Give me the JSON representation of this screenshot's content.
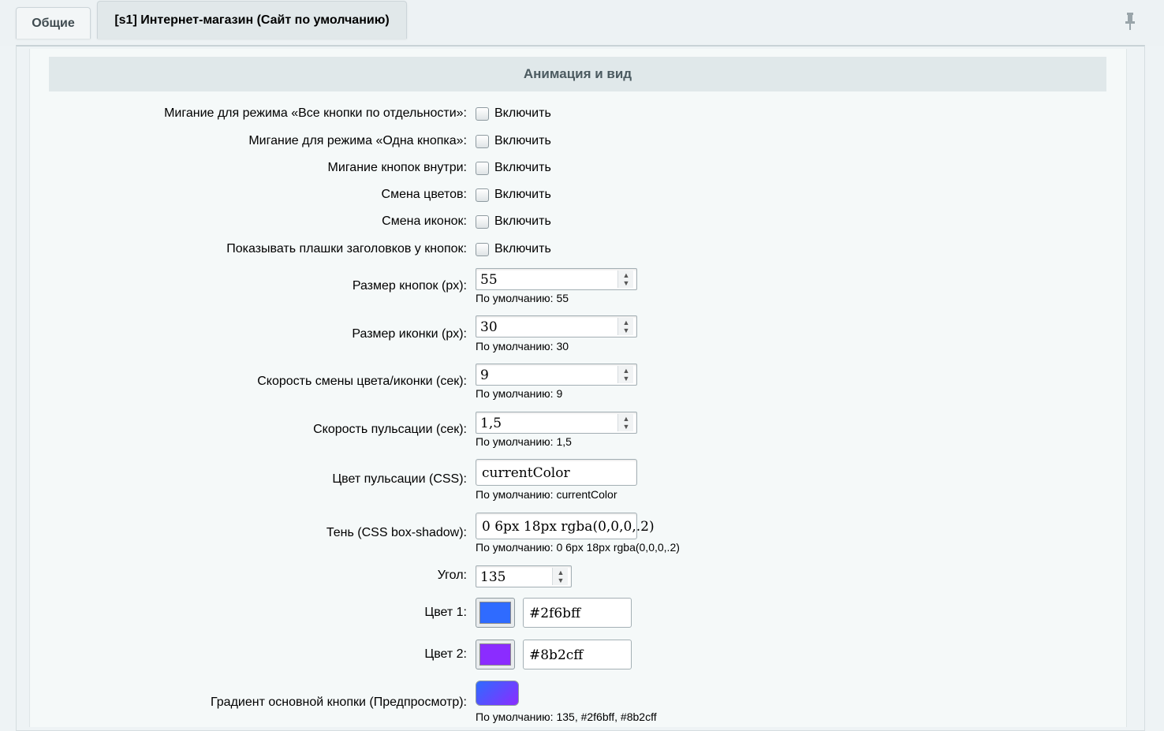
{
  "tabs": [
    {
      "label": "Общие"
    },
    {
      "label": "[s1] Интернет-магазин (Сайт по умолчанию)"
    }
  ],
  "section_title": "Анимация и вид",
  "checkboxes": [
    {
      "label": "Мигание для режима «Все кнопки по отдельности»:",
      "text": "Включить"
    },
    {
      "label": "Мигание для режима «Одна кнопка»:",
      "text": "Включить"
    },
    {
      "label": "Мигание кнопок внутри:",
      "text": "Включить"
    },
    {
      "label": "Смена цветов:",
      "text": "Включить"
    },
    {
      "label": "Смена иконок:",
      "text": "Включить"
    },
    {
      "label": "Показывать плашки заголовков у кнопок:",
      "text": "Включить"
    }
  ],
  "numbers": [
    {
      "label": "Размер кнопок (px):",
      "value": "55",
      "hint": "По умолчанию: 55"
    },
    {
      "label": "Размер иконки (px):",
      "value": "30",
      "hint": "По умолчанию: 30"
    },
    {
      "label": "Скорость смены цвета/иконки (сек):",
      "value": "9",
      "hint": "По умолчанию: 9"
    },
    {
      "label": "Скорость пульсации (сек):",
      "value": "1,5",
      "hint": "По умолчанию: 1,5"
    }
  ],
  "texts": [
    {
      "label": "Цвет пульсации (CSS):",
      "value": "currentColor",
      "hint": "По умолчанию: currentColor"
    },
    {
      "label": "Тень (CSS box-shadow):",
      "value": "0 6px 18px rgba(0,0,0,.2)",
      "hint": "По умолчанию: 0 6px 18px rgba(0,0,0,.2)"
    }
  ],
  "angle": {
    "label": "Угол:",
    "value": "135"
  },
  "colors": [
    {
      "label": "Цвет 1:",
      "value": "#2f6bff"
    },
    {
      "label": "Цвет 2:",
      "value": "#8b2cff"
    }
  ],
  "gradient": {
    "label": "Градиент основной кнопки (Предпросмотр):",
    "hint": "По умолчанию: 135, #2f6bff, #8b2cff",
    "from": "#2f6bff",
    "to": "#8b2cff"
  }
}
